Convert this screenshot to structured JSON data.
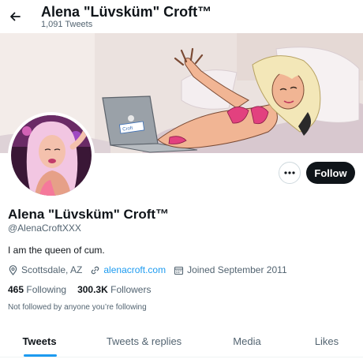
{
  "header": {
    "title": "Alena \"Lüvsküm\" Croft™",
    "tweet_count": "1,091 Tweets",
    "back_icon": "arrow-left-icon"
  },
  "banner": {
    "laptop_sticker": "Croft"
  },
  "profile": {
    "display_name": "Alena \"Lüvsküm\" Croft™",
    "handle": "@AlenaCroftXXX",
    "bio": "I am the queen of cum.",
    "location": "Scottsdale, AZ",
    "website": "alenacroft.com",
    "joined": "Joined September 2011",
    "following_count": "465",
    "following_label": "Following",
    "followers_count": "300.3K",
    "followers_label": "Followers",
    "not_followed_text": "Not followed by anyone you’re following"
  },
  "actions": {
    "more_icon": "more-horizontal-icon",
    "follow_label": "Follow"
  },
  "tabs": [
    {
      "label": "Tweets",
      "active": true
    },
    {
      "label": "Tweets & replies",
      "active": false
    },
    {
      "label": "Media",
      "active": false
    },
    {
      "label": "Likes",
      "active": false
    }
  ],
  "colors": {
    "accent": "#1d9bf0",
    "text_primary": "#0f1419",
    "text_secondary": "#536471",
    "follow_button": "#0f1419",
    "border": "#cfd9de"
  }
}
